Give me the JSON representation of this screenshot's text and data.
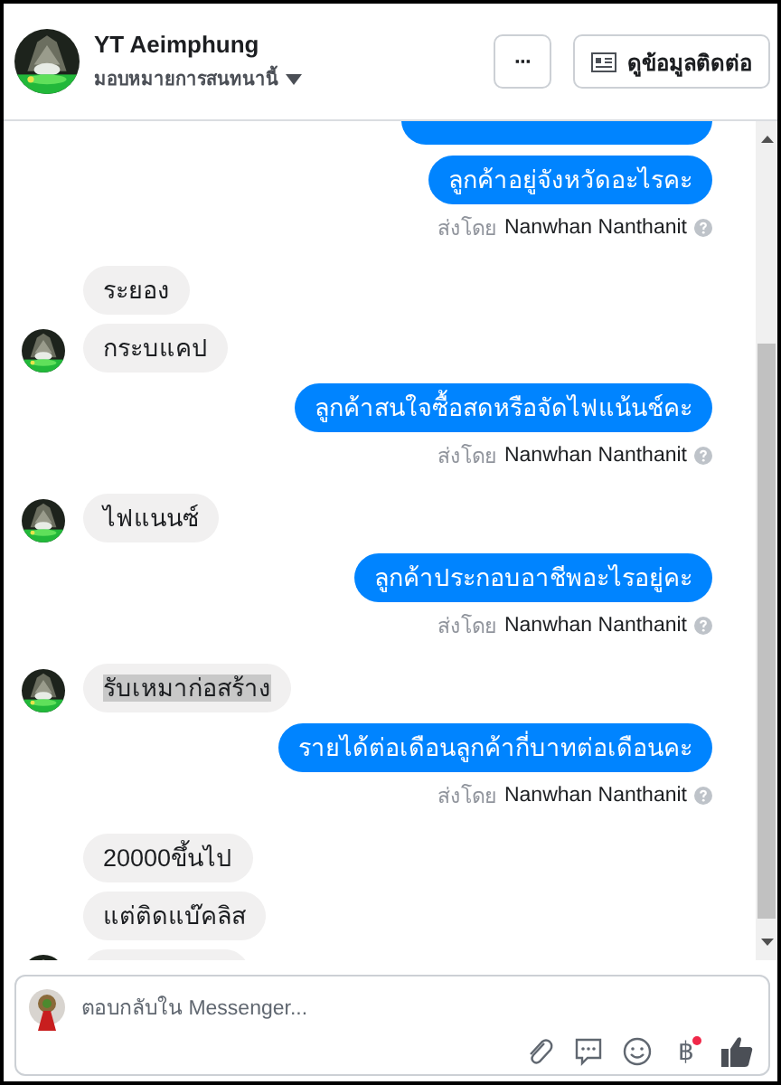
{
  "header": {
    "title": "YT Aeimphung",
    "subtitle": "มอบหมายการสนทนานี้",
    "more_button": "···",
    "contact_button": "ดูข้อมูลติดต่อ"
  },
  "messages": [
    {
      "kind": "partial_outgoing"
    },
    {
      "kind": "outgoing",
      "text": "ลูกค้าอยู่จังหวัดอะไรคะ"
    },
    {
      "kind": "sent_by",
      "label": "ส่งโดย",
      "name": "Nanwhan Nanthanit"
    },
    {
      "kind": "incoming",
      "text": "ระยอง",
      "avatar": false,
      "highlighted": false
    },
    {
      "kind": "incoming",
      "text": "กระบแคป",
      "avatar": true,
      "highlighted": false
    },
    {
      "kind": "outgoing",
      "text": "ลูกค้าสนใจซื้อสดหรือจัดไฟแน้นช์คะ"
    },
    {
      "kind": "sent_by",
      "label": "ส่งโดย",
      "name": "Nanwhan Nanthanit"
    },
    {
      "kind": "incoming",
      "text": "ไฟแนนซ์",
      "avatar": true,
      "highlighted": false
    },
    {
      "kind": "outgoing",
      "text": "ลูกค้าประกอบอาชีพอะไรอยู่คะ"
    },
    {
      "kind": "sent_by",
      "label": "ส่งโดย",
      "name": "Nanwhan Nanthanit"
    },
    {
      "kind": "incoming",
      "text": "รับเหมาก่อสร้าง",
      "avatar": true,
      "highlighted": true
    },
    {
      "kind": "outgoing",
      "text": "รายได้ต่อเดือนลูกค้ากี่บาทต่อเดือนคะ"
    },
    {
      "kind": "sent_by",
      "label": "ส่งโดย",
      "name": "Nanwhan Nanthanit"
    },
    {
      "kind": "incoming",
      "text": "20000ขึ้นไป",
      "avatar": false,
      "highlighted": false
    },
    {
      "kind": "incoming",
      "text": "แต่ติดแบ๊คลิส",
      "avatar": false,
      "highlighted": false
    },
    {
      "kind": "partial_incoming"
    }
  ],
  "composer": {
    "placeholder": "ตอบกลับใน Messenger...",
    "currency_symbol": "฿",
    "notification": true
  }
}
